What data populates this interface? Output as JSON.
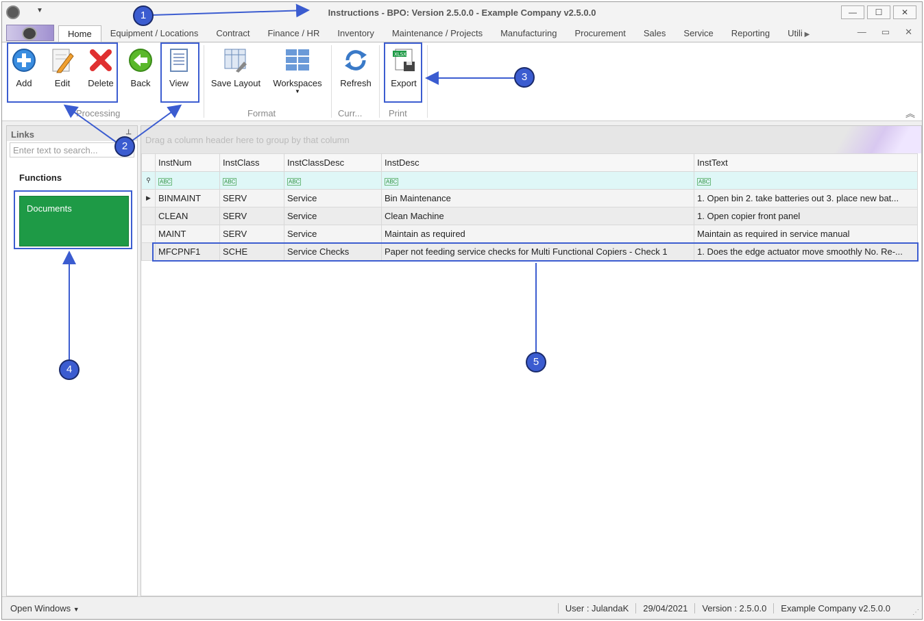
{
  "window": {
    "title_prefix": "Instructions",
    "title_rest": " - BPO: Version 2.5.0.0 - Example Company v2.5.0.0",
    "qat": "▼",
    "controls": [
      "—",
      "☐",
      "✕"
    ]
  },
  "tabs": [
    "Home",
    "Equipment / Locations",
    "Contract",
    "Finance / HR",
    "Inventory",
    "Maintenance / Projects",
    "Manufacturing",
    "Procurement",
    "Sales",
    "Service",
    "Reporting",
    "Utili"
  ],
  "mdi_controls": [
    "—",
    "▭",
    "✕"
  ],
  "ribbon": {
    "add": "Add",
    "edit": "Edit",
    "delete": "Delete",
    "back": "Back",
    "view": "View",
    "save_layout": "Save Layout",
    "workspaces": "Workspaces",
    "refresh": "Refresh",
    "export": "Export",
    "groups": {
      "processing": "Processing",
      "format": "Format",
      "curr": "Curr...",
      "print": "Print"
    }
  },
  "links": {
    "header": "Links",
    "search_placeholder": "Enter text to search...",
    "functions": "Functions",
    "documents": "Documents"
  },
  "grid": {
    "group_hint": "Drag a column header here to group by that column",
    "columns": [
      "InstNum",
      "InstClass",
      "InstClassDesc",
      "InstDesc",
      "InstText"
    ],
    "rows": [
      [
        "BINMAINT",
        "SERV",
        "Service",
        "Bin Maintenance",
        "1. Open bin 2. take batteries out 3. place new bat..."
      ],
      [
        "CLEAN",
        "SERV",
        "Service",
        "Clean Machine",
        "1. Open copier front panel"
      ],
      [
        "MAINT",
        "SERV",
        "Service",
        "Maintain as required",
        "Maintain as required in service manual"
      ],
      [
        "MFCPNF1",
        "SCHE",
        "Service Checks",
        "Paper not feeding service checks for Multi Functional Copiers - Check 1",
        "1. Does the edge actuator move smoothly No. Re-..."
      ]
    ]
  },
  "status": {
    "open_windows": "Open Windows",
    "user": "User : JulandaK",
    "date": "29/04/2021",
    "version": "Version : 2.5.0.0",
    "company": "Example Company v2.5.0.0"
  },
  "callouts": [
    "1",
    "2",
    "3",
    "4",
    "5"
  ],
  "colors": {
    "accent": "#3b5cd0",
    "documents_tile": "#1e9a46",
    "filter_row": "#dff7f7"
  }
}
